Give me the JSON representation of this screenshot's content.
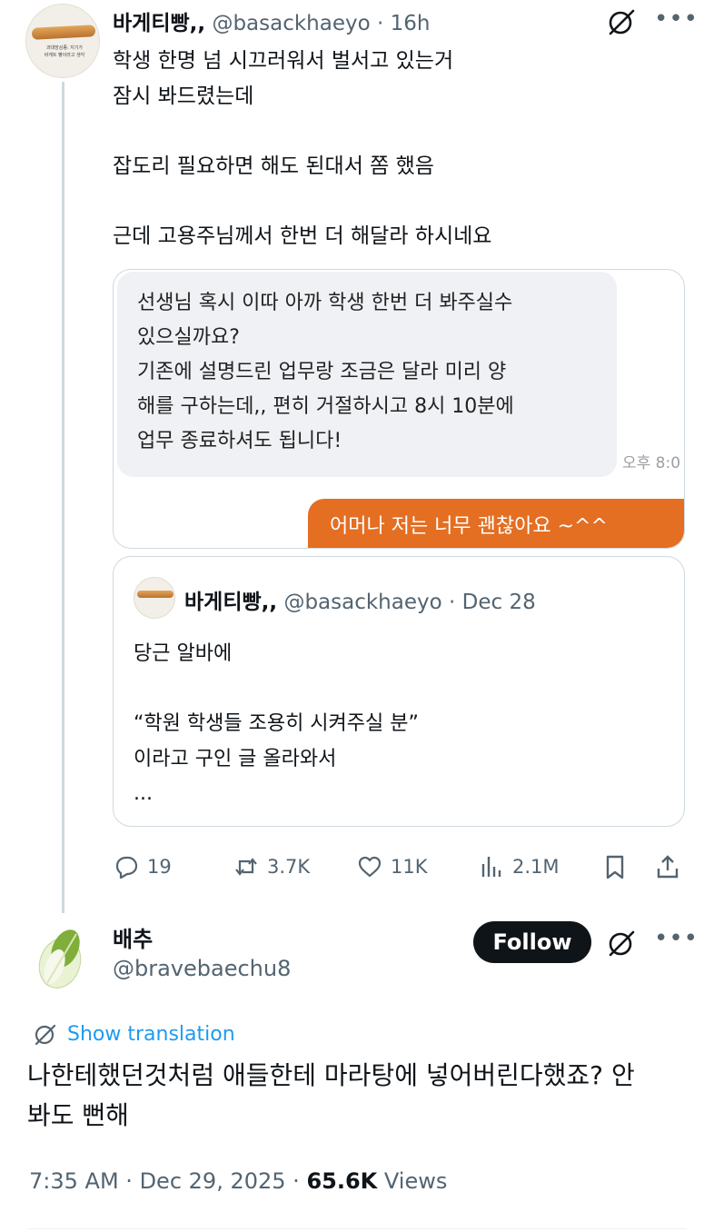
{
  "thread_tweet": {
    "avatar_caption": "과대망상종: 지기가\n바게트 빵이라고 생각",
    "display_name": "바게티빵,,",
    "handle": "@basackhaeyo",
    "separator": "·",
    "time": "16h",
    "body": "학생 한명 넘 시끄러워서 벌서고 있는거\n잠시 봐드렸는데\n\n잡도리 필요하면 해도 된대서 쫌 했음\n\n근데 고용주님께서 한번 더 해달라 하시네요",
    "media": {
      "incoming_message": "선생님 혹시 이따 아까 학생 한번 더 봐주실수\n있으실까요?\n기존에 설명드린 업무랑 조금은 달라 미리 양\n해를 구하는데,, 편히 거절하시고 8시 10분에\n업무 종료하셔도 됩니다!",
      "incoming_time": "오후 8:0",
      "outgoing_message": "어머나 저는 너무 괜찮아요 ~^^"
    },
    "quoted": {
      "display_name": "바게티빵,,",
      "handle": "@basackhaeyo",
      "separator": "·",
      "date": "Dec 28",
      "body": "당근 알바에\n\n“학원 학생들 조용히 시켜주실 분”\n이라고 구인 글 올라와서\n..."
    },
    "stats": {
      "replies": "19",
      "reposts": "3.7K",
      "likes": "11K",
      "views": "2.1M"
    }
  },
  "main_tweet": {
    "display_name": "배추",
    "handle": "@bravebaechu8",
    "follow_label": "Follow",
    "show_translation": "Show translation",
    "body": "나한테했던것처럼 애들한테 마라탕에 넣어버린다했죠? 안\n봐도 뻔해",
    "time": "7:35 AM",
    "date": "Dec 29, 2025",
    "separator": "·",
    "views_count": "65.6K",
    "views_label": "Views"
  },
  "colors": {
    "text": "#0f1419",
    "secondary": "#536471",
    "link": "#1d9bf0",
    "chat_outgoing": "#e46e22",
    "chat_incoming": "#eff1f4",
    "border": "#cfd9de"
  },
  "icons": [
    "grok-icon",
    "more-icon",
    "reply-icon",
    "repost-icon",
    "like-icon",
    "views-icon",
    "bookmark-icon",
    "share-icon",
    "translate-icon"
  ]
}
